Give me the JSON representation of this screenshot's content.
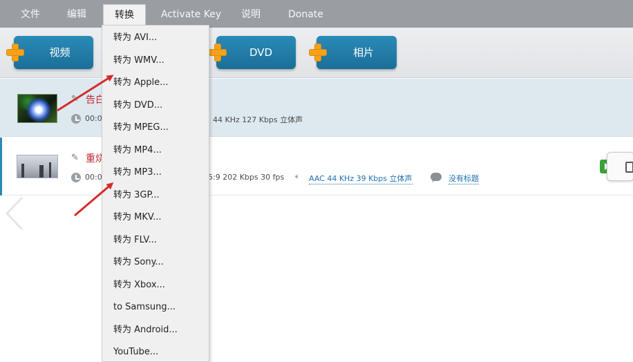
{
  "menubar": {
    "items": [
      "文件",
      "编辑",
      "转换",
      "Activate Key",
      "说明",
      "Donate"
    ]
  },
  "toolbar": {
    "video_label": "视频",
    "dvd_label": "DVD",
    "photo_label": "相片"
  },
  "files": [
    {
      "title": "告白",
      "duration": "00:0",
      "meta": "44 KHz  127 Kbps  立体声"
    },
    {
      "title": "重烧",
      "duration": "00:0",
      "meta": "5:9  202 Kbps  30 fps",
      "audio_link": "AAC  44 KHz  39 Kbps  立体声",
      "subtitle_link": "没有标题"
    }
  ],
  "dropdown": {
    "items": [
      "转为 AVI...",
      "转为 WMV...",
      "转为 Apple...",
      "转为 DVD...",
      "转为 MPEG...",
      "转为 MP4...",
      "转为 MP3...",
      "转为 3GP...",
      "转为 MKV...",
      "转为 FLV...",
      "转为 Sony...",
      "转为 Xbox...",
      "to Samsung...",
      "转为 Android...",
      "YouTube..."
    ]
  },
  "colors": {
    "menubar": "#9a9ea3",
    "button": "#1f7aa6",
    "accent_orange": "#f5a21b",
    "title_red": "#c1272d",
    "row_selected": "#dde9ef",
    "arrow_red": "#d42a2a"
  },
  "icons": [
    "plus-icon",
    "pencil-icon",
    "clock-icon",
    "speaker-icon",
    "comment-icon",
    "play-icon",
    "chevron-left-icon"
  ]
}
